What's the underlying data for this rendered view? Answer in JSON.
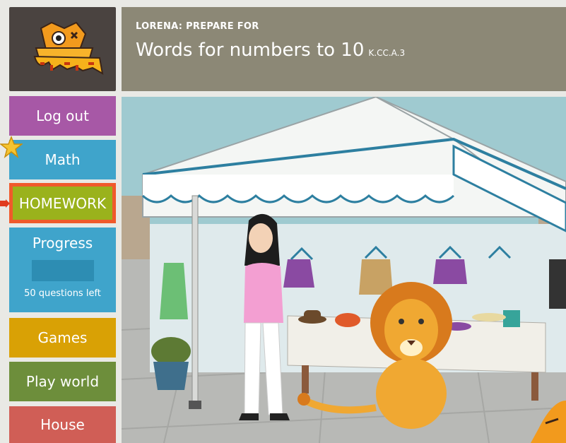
{
  "header": {
    "prepare_label": "LORENA: PREPARE FOR",
    "title": "Words for numbers to 10",
    "standard": "K.CC.A.3"
  },
  "sidebar": {
    "logout": "Log out",
    "math": "Math",
    "homework": "HOMEWORK",
    "progress": {
      "label": "Progress",
      "questions_left": "50 questions left"
    },
    "games": "Games",
    "play_world": "Play world",
    "house": "House"
  },
  "colors": {
    "logout": "#a758a6",
    "math": "#3fa4cb",
    "homework_border": "#f05a2b",
    "homework_fill": "#9ab21c",
    "games": "#d9a105",
    "play_world": "#6d8e3b",
    "house": "#d05e56",
    "header": "#8c8876"
  },
  "icons": [
    "sumdog-logo",
    "star-icon",
    "arrow-icon",
    "lion",
    "avatar-girl",
    "orange-dog-icon"
  ]
}
